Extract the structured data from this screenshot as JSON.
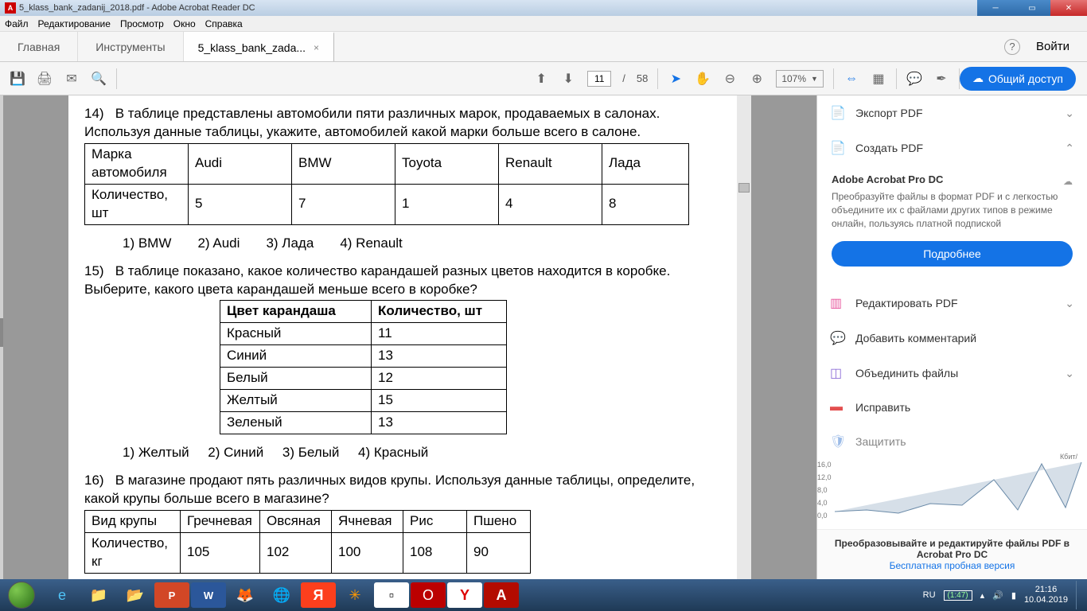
{
  "titlebar": {
    "text": "5_klass_bank_zadanij_2018.pdf - Adobe Acrobat Reader DC"
  },
  "menu": {
    "file": "Файл",
    "edit": "Редактирование",
    "view": "Просмотр",
    "window": "Окно",
    "help": "Справка"
  },
  "tabs": {
    "home": "Главная",
    "tools": "Инструменты",
    "doc": "5_klass_bank_zada...",
    "close": "×",
    "helpicon": "?",
    "signin": "Войти"
  },
  "toolbar": {
    "page_cur": "11",
    "page_sep": "/",
    "page_total": "58",
    "zoom": "107%",
    "share": "Общий доступ"
  },
  "rightpanel": {
    "export": "Экспорт PDF",
    "create": "Создать PDF",
    "section_title": "Adobe Acrobat Pro DC",
    "section_body": "Преобразуйте файлы в формат PDF и с легкостью объедините их с файлами других типов в режиме онлайн, пользуясь платной подпиской",
    "more_btn": "Подробнее",
    "edit": "Редактировать PDF",
    "comment": "Добавить комментарий",
    "combine": "Объединить файлы",
    "fix": "Исправить",
    "protect": "Защитить",
    "footer1": "Преобразовывайте и редактируйте файлы PDF в Acrobat Pro DC",
    "footer2": "Бесплатная пробная версия",
    "chart_labels": {
      "y0": "0,0",
      "y4": "4,0",
      "y8": "8,0",
      "y12": "12,0",
      "y16": "16,0",
      "unit": "Кбит/"
    }
  },
  "doc": {
    "p14_num": "14)",
    "p14_text": "В таблице представлены автомобили пяти различных марок, продаваемых в салонах. Используя данные таблицы, укажите, автомобилей какой марки больше всего в салоне.",
    "p14_row1": [
      "Марка автомобиля",
      "Audi",
      "BMW",
      "Toyota",
      "Renault",
      "Лада"
    ],
    "p14_row2": [
      "Количество, шт",
      "5",
      "7",
      "1",
      "4",
      "8"
    ],
    "p14_ans": [
      "1)  BMW",
      "2) Audi",
      "3) Лада",
      "4) Renault"
    ],
    "p15_num": "15)",
    "p15_text": "В таблице показано, какое количество карандашей разных цветов находится в коробке. Выберите, какого цвета карандашей меньше всего в коробке?",
    "p15_head": [
      "Цвет карандаша",
      "Количество, шт"
    ],
    "p15_rows": [
      [
        "Красный",
        "11"
      ],
      [
        "Синий",
        "13"
      ],
      [
        "Белый",
        "12"
      ],
      [
        "Желтый",
        "15"
      ],
      [
        "Зеленый",
        "13"
      ]
    ],
    "p15_ans": [
      "1)  Желтый",
      "2) Синий",
      "3)   Белый",
      "4) Красный"
    ],
    "p16_num": "16)",
    "p16_text": "В магазине продают пять различных видов крупы. Используя данные таблицы, определите, какой крупы больше всего в магазине?",
    "p16_row1": [
      "Вид крупы",
      "Гречневая",
      "Овсяная",
      "Ячневая",
      "Рис",
      "Пшено"
    ],
    "p16_row2": [
      "Количество, кг",
      "105",
      "102",
      "100",
      "108",
      "90"
    ]
  },
  "tray": {
    "lang": "RU",
    "battery": "(1:47)",
    "time": "21:16",
    "date": "10.04.2019"
  }
}
